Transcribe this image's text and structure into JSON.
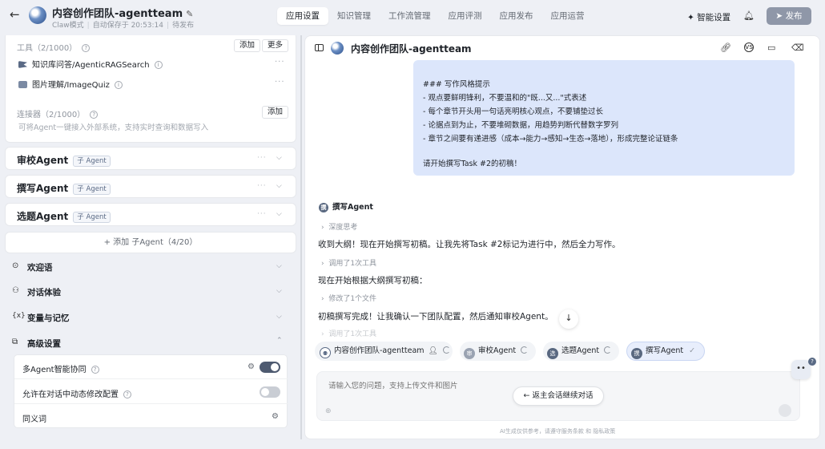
{
  "header": {
    "back_icon": "arrow-left-icon",
    "title": "内容创作团队-agentteam",
    "mode": "Claw模式",
    "autosave": "自动保存于 20:53:14",
    "status": "待发布",
    "tabs": [
      "应用设置",
      "知识管理",
      "工作流管理",
      "应用评测",
      "应用发布",
      "应用运营"
    ],
    "active_tab": "应用设置",
    "smart_settings": "智能设置",
    "publish": "发布"
  },
  "left": {
    "tools": {
      "label": "工具（2/1000）",
      "add": "添加",
      "more": "更多",
      "items": [
        {
          "name": "知识库问答/AgenticRAGSearch",
          "icon": "flag-icon"
        },
        {
          "name": "图片理解/ImageQuiz",
          "icon": "image-icon"
        }
      ]
    },
    "connectors": {
      "label": "连接器（2/1000）",
      "add": "添加",
      "desc": "可将Agent一键接入外部系统，支持实时查询和数据写入"
    },
    "agents": [
      {
        "name": "审校Agent",
        "badge": "子 Agent"
      },
      {
        "name": "撰写Agent",
        "badge": "子 Agent"
      },
      {
        "name": "选题Agent",
        "badge": "子 Agent"
      }
    ],
    "add_agent": "+ 添加 子Agent（4/20）",
    "settings": [
      {
        "label": "欢迎语",
        "icon": "chat-icon"
      },
      {
        "label": "对话体验",
        "icon": "user-voice-icon"
      },
      {
        "label": "变量与记忆",
        "icon": "variable-icon"
      },
      {
        "label": "高级设置",
        "icon": "layers-icon"
      }
    ],
    "advanced": {
      "multi_agent": "多Agent智能协同",
      "multi_agent_on": true,
      "dynamic_config": "允许在对话中动态修改配置",
      "dynamic_config_on": false,
      "synonyms": "同义词"
    }
  },
  "right": {
    "title": "内容创作团队-agentteam",
    "prompt_lines": [
      "### 写作风格提示",
      "- 观点要鲜明锋利，不要温和的\"既...又...\"式表述",
      "- 每个章节开头用一句话亮明核心观点，不要铺垫过长",
      "- 论据点到为止，不要堆砌数据，用趋势判断代替数字罗列",
      "- 章节之间要有递进感（成本→能力→感知→生态→落地），形成完整论证链条",
      "",
      "请开始撰写Task #2的初稿！"
    ],
    "agent_name": "撰写Agent",
    "agent_avatar": "撰",
    "deep_think": "深度思考",
    "msg1": "收到大纲！现在开始撰写初稿。让我先将Task #2标记为进行中，然后全力写作。",
    "tool_used": "调用了1次工具",
    "msg2": "现在开始根据大纲撰写初稿：",
    "file_modified": "修改了1个文件",
    "msg3": "初稿撰写完成！让我确认一下团队配置，然后通知审校Agent。",
    "tool_used2": "调用了1次工具",
    "chips": [
      {
        "name": "内容创作团队-agentteam",
        "avatar": ""
      },
      {
        "name": "审校Agent",
        "avatar": "审"
      },
      {
        "name": "选题Agent",
        "avatar": "选"
      },
      {
        "name": "撰写Agent",
        "avatar": "撰"
      }
    ],
    "input_placeholder": "请输入您的问题，支持上传文件和图片",
    "return_btn": "返主会话继续对话",
    "footer": "AI生成仅供参考，请遵守服务条款 和 隐私政策"
  }
}
